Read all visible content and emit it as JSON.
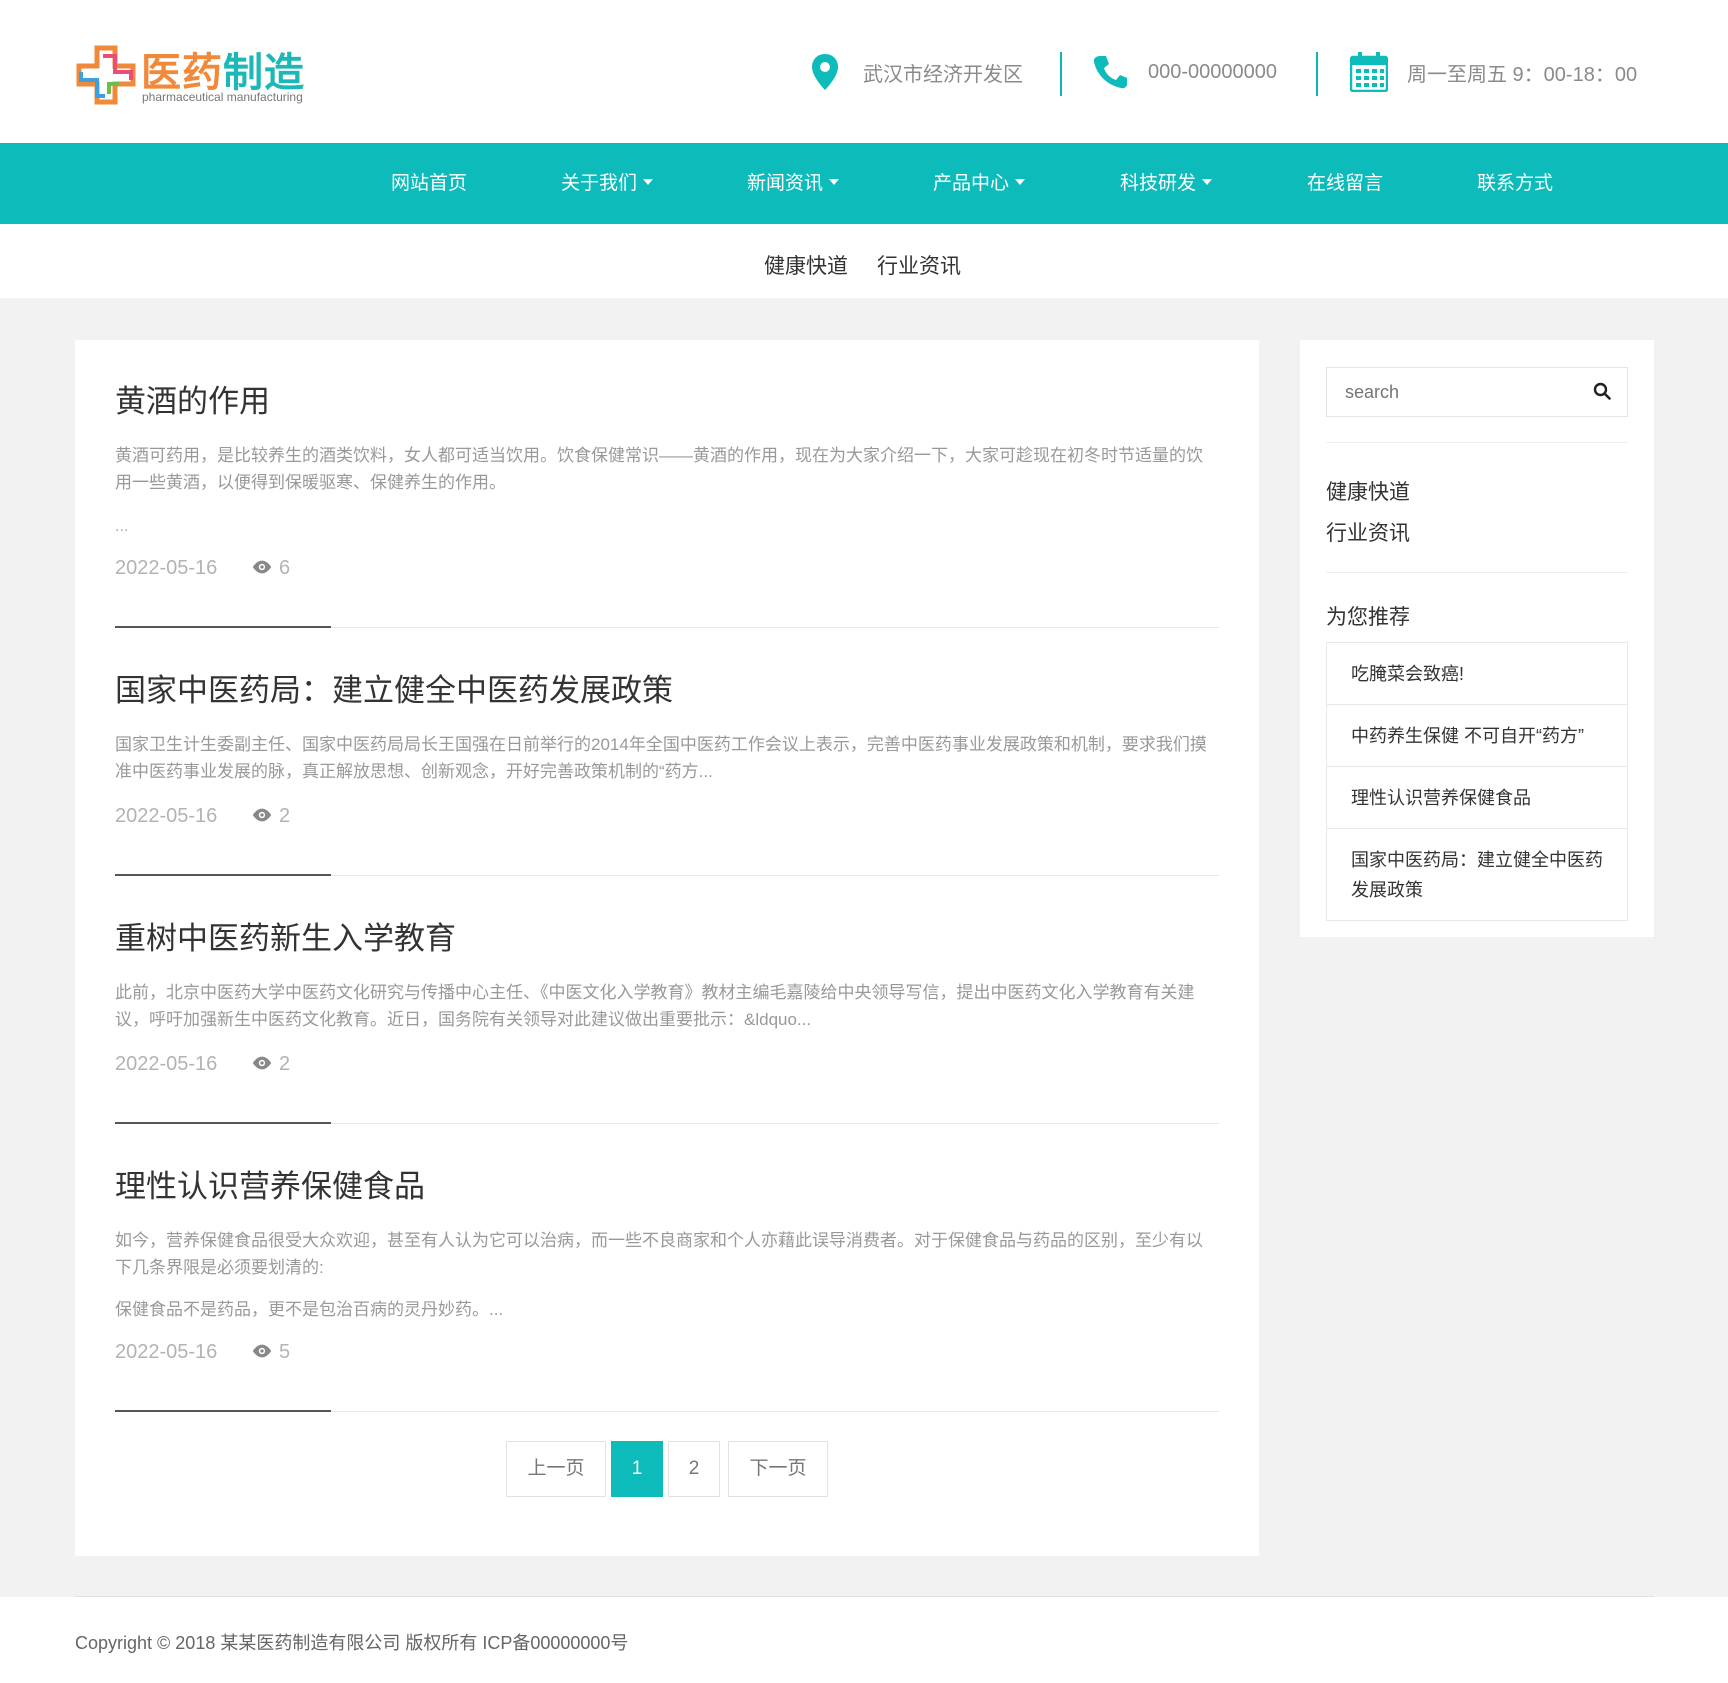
{
  "header": {
    "logo": {
      "title_part1": "医药",
      "title_part2": "制造",
      "subtitle": "pharmaceutical manufacturing"
    },
    "address": "武汉市经济开发区",
    "phone": "000-00000000",
    "hours": "周一至周五 9：00-18：00",
    "icons": {
      "address": "map-pin-icon",
      "phone": "phone-icon",
      "hours": "calendar-icon"
    },
    "accent_color": "#0ebbbb"
  },
  "nav": {
    "items": [
      {
        "label": "网站首页",
        "dropdown": false
      },
      {
        "label": "关于我们",
        "dropdown": true
      },
      {
        "label": "新闻资讯",
        "dropdown": true
      },
      {
        "label": "产品中心",
        "dropdown": true
      },
      {
        "label": "科技研发",
        "dropdown": true
      },
      {
        "label": "在线留言",
        "dropdown": false
      },
      {
        "label": "联系方式",
        "dropdown": false
      }
    ]
  },
  "subnav": {
    "items": [
      "健康快道",
      "行业资讯"
    ]
  },
  "articles": [
    {
      "title": "黄酒的作用",
      "summary": "黄酒可药用，是比较养生的酒类饮料，女人都可适当饮用。饮食保健常识——黄酒的作用，现在为大家介绍一下，大家可趁现在初冬时节适量的饮用一些黄酒，以便得到保暖驱寒、保健养生的作用。",
      "more": "...",
      "date": "2022-05-16",
      "views": "6"
    },
    {
      "title": "国家中医药局：建立健全中医药发展政策",
      "summary": "国家卫生计生委副主任、国家中医药局局长王国强在日前举行的2014年全国中医药工作会议上表示，完善中医药事业发展政策和机制，要求我们摸准中医药事业发展的脉，真正解放思想、创新观念，开好完善政策机制的“药方...",
      "more": "",
      "date": "2022-05-16",
      "views": "2"
    },
    {
      "title": "重树中医药新生入学教育",
      "summary": "此前，北京中医药大学中医药文化研究与传播中心主任、《中医文化入学教育》教材主编毛嘉陵给中央领导写信，提出中医药文化入学教育有关建议，呼吁加强新生中医药文化教育。近日，国务院有关领导对此建议做出重要批示：&ldquo...",
      "more": "",
      "date": "2022-05-16",
      "views": "2"
    },
    {
      "title": "理性认识营养保健食品",
      "summary": "如今，营养保健食品很受大众欢迎，甚至有人认为它可以治病，而一些不良商家和个人亦藉此误导消费者。对于保健食品与药品的区别，至少有以下几条界限是必须要划清的:",
      "more": "保健食品不是药品，更不是包治百病的灵丹妙药。...",
      "date": "2022-05-16",
      "views": "5"
    }
  ],
  "pagination": {
    "prev": "上一页",
    "pages": [
      "1",
      "2"
    ],
    "current": "1",
    "next": "下一页"
  },
  "sidebar": {
    "search_placeholder": "search",
    "categories": [
      "健康快道",
      "行业资讯"
    ],
    "recommend_title": "为您推荐",
    "recommend": [
      "吃腌菜会致癌!",
      "中药养生保健 不可自开“药方”",
      "理性认识营养保健食品",
      "国家中医药局：建立健全中医药发展政策"
    ]
  },
  "footer": {
    "copyright": "Copyright © 2018 某某医药制造有限公司 版权所有 ICP备00000000号"
  }
}
